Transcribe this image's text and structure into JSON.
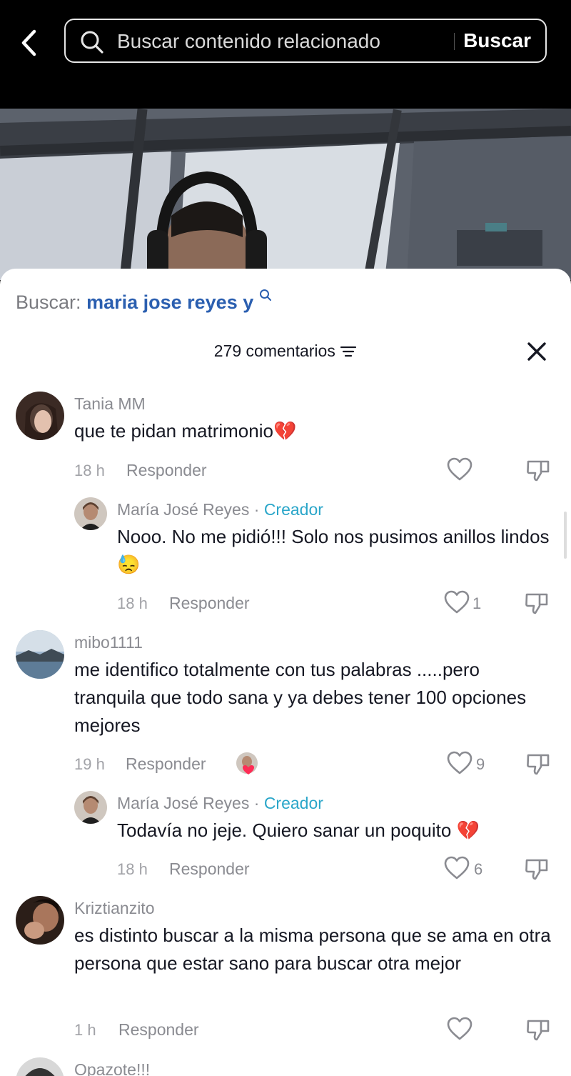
{
  "search": {
    "placeholder": "Buscar contenido relacionado",
    "submit_label": "Buscar"
  },
  "sheet": {
    "related_prefix": "Buscar:",
    "related_query": "maria jose reyes y",
    "comment_count_label": "279 comentarios"
  },
  "comments": [
    {
      "username": "Tania MM",
      "text": "que te pidan matrimonio",
      "emoji": "💔",
      "time": "18 h",
      "reply_label": "Responder",
      "likes": ""
    },
    {
      "username": "María José Reyes",
      "creator_label": "Creador",
      "text": "Nooo. No me pidió!!! Solo nos pusimos anillos lindos",
      "emoji": "😓",
      "time": "18 h",
      "reply_label": "Responder",
      "likes": "1"
    },
    {
      "username": "mibo1111",
      "text": "me identifico totalmente con tus palabras .....pero tranquila que todo sana y ya debes tener 100 opciones mejores",
      "time": "19 h",
      "reply_label": "Responder",
      "likes": "9"
    },
    {
      "username": "María José Reyes",
      "creator_label": "Creador",
      "text": "Todavía no jeje. Quiero sanar un poquito",
      "emoji": "💔",
      "time": "18 h",
      "reply_label": "Responder",
      "likes": "6"
    },
    {
      "username": "Kriztianzito",
      "text": "es distinto buscar a la misma persona que se ama en otra persona que estar sano para buscar otra mejor",
      "time": "1 h",
      "reply_label": "Responder",
      "likes": ""
    },
    {
      "username": "Opazote!!!"
    }
  ],
  "colors": {
    "creator": "#2aa6c9",
    "query": "#2b5fb0"
  }
}
